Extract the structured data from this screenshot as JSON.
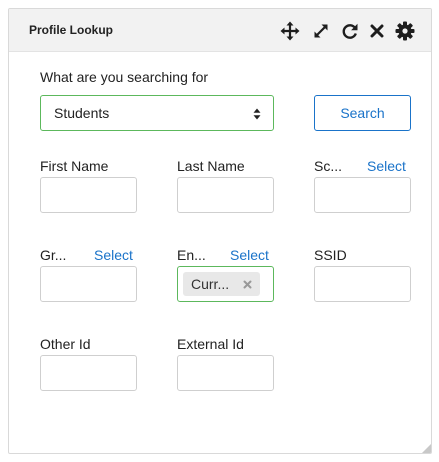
{
  "header": {
    "title": "Profile Lookup",
    "icons": [
      "move-icon",
      "expand-icon",
      "refresh-icon",
      "close-icon",
      "settings-icon"
    ]
  },
  "search": {
    "prompt_label": "What are you searching for",
    "type_value": "Students",
    "search_button": "Search"
  },
  "fields": {
    "first_name": "First Name",
    "last_name": "Last Name",
    "school": "Sc...",
    "grade": "Gr...",
    "enrollment": "En...",
    "ssid": "SSID",
    "other_id": "Other Id",
    "external_id": "External Id",
    "select_link": "Select"
  },
  "enrollment_tag": {
    "value": "Curr..."
  },
  "colors": {
    "accent": "#1a73c9",
    "valid_border": "#5cb85c",
    "header_bg": "#f2f2f2"
  }
}
